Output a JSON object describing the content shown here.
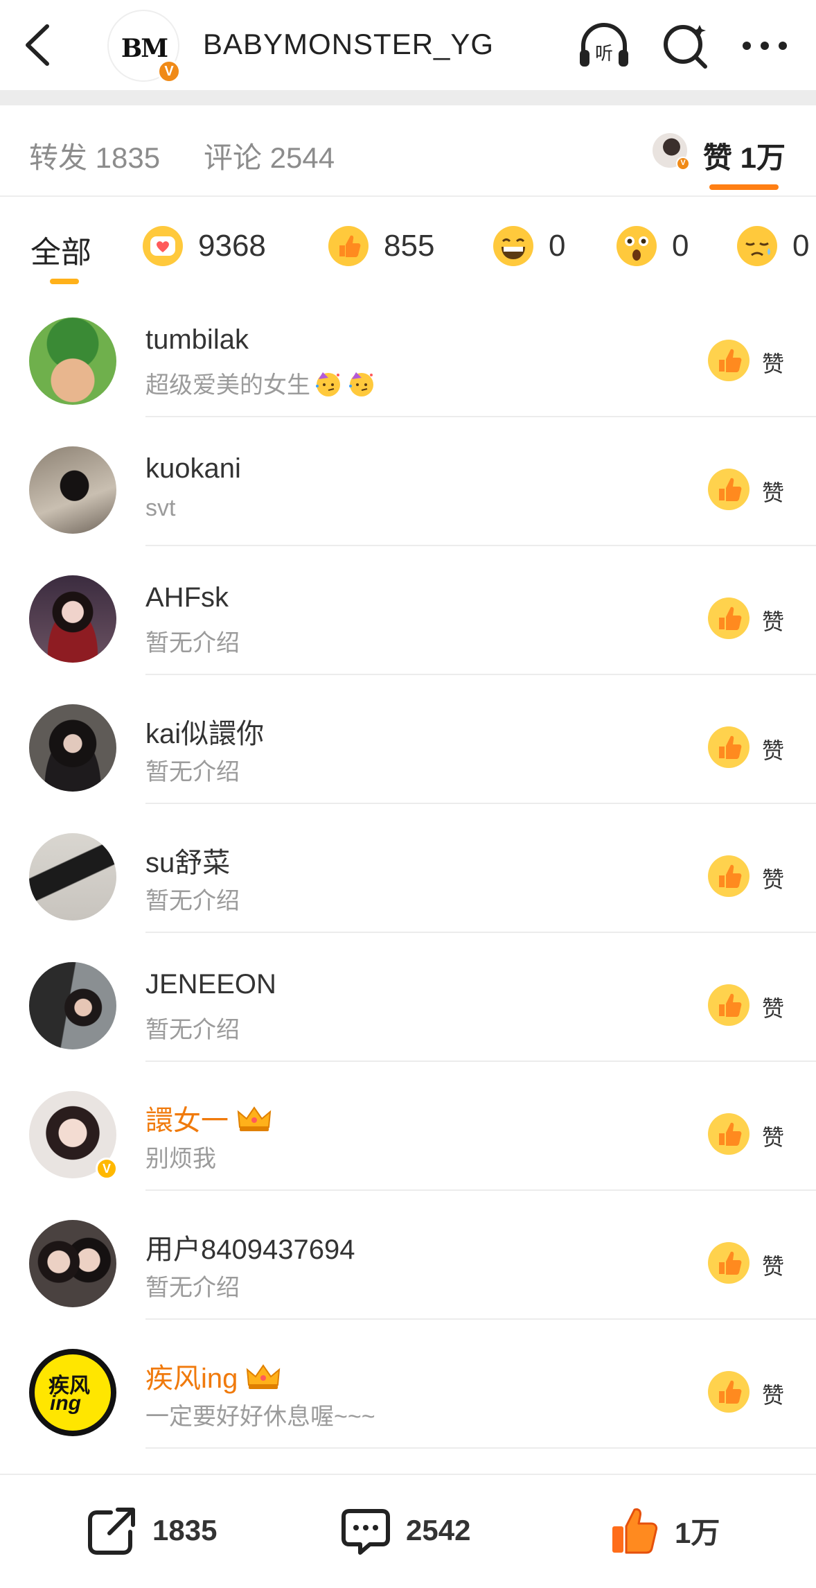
{
  "header": {
    "title": "BABYMONSTER_YG",
    "logo_text": "BM",
    "verified_mark": "V",
    "listen_label": "听"
  },
  "tabs": {
    "repost": "转发 1835",
    "comment": "评论 2544",
    "like": "赞 1万"
  },
  "filters": {
    "all": "全部",
    "reactions": [
      {
        "icon": "heart-face-icon",
        "count": "9368"
      },
      {
        "icon": "thumbs-up-icon",
        "count": "855"
      },
      {
        "icon": "grin-icon",
        "count": "0"
      },
      {
        "icon": "surprised-icon",
        "count": "0"
      },
      {
        "icon": "sad-icon",
        "count": "0"
      }
    ]
  },
  "likers": [
    {
      "name": "tumbilak",
      "bio": "超级爱美的女生",
      "vip": false
    },
    {
      "name": "kuokani",
      "bio": "svt",
      "vip": false
    },
    {
      "name": "AHFsk",
      "bio": "暂无介绍",
      "vip": false
    },
    {
      "name": "kai似譞你",
      "bio": "暂无介绍",
      "vip": false
    },
    {
      "name": "su舒菜",
      "bio": "暂无介绍",
      "vip": false
    },
    {
      "name": "JENEEON",
      "bio": "暂无介绍",
      "vip": false
    },
    {
      "name": "譞女一",
      "bio": "别烦我",
      "vip": true
    },
    {
      "name": "用户8409437694",
      "bio": "暂无介绍",
      "vip": false
    },
    {
      "name": "疾风ing",
      "bio": "一定要好好休息喔~~~",
      "vip": true
    }
  ],
  "like_button_label": "赞",
  "avatar_texts": {
    "jifeng_line1": "疾风",
    "jifeng_line2": "ing"
  },
  "bottom": {
    "repost": "1835",
    "comment": "2542",
    "like": "1万"
  },
  "colors": {
    "accent": "#ff7f14",
    "vip_name": "#f07a0c",
    "thumb": "#ffb11a"
  }
}
